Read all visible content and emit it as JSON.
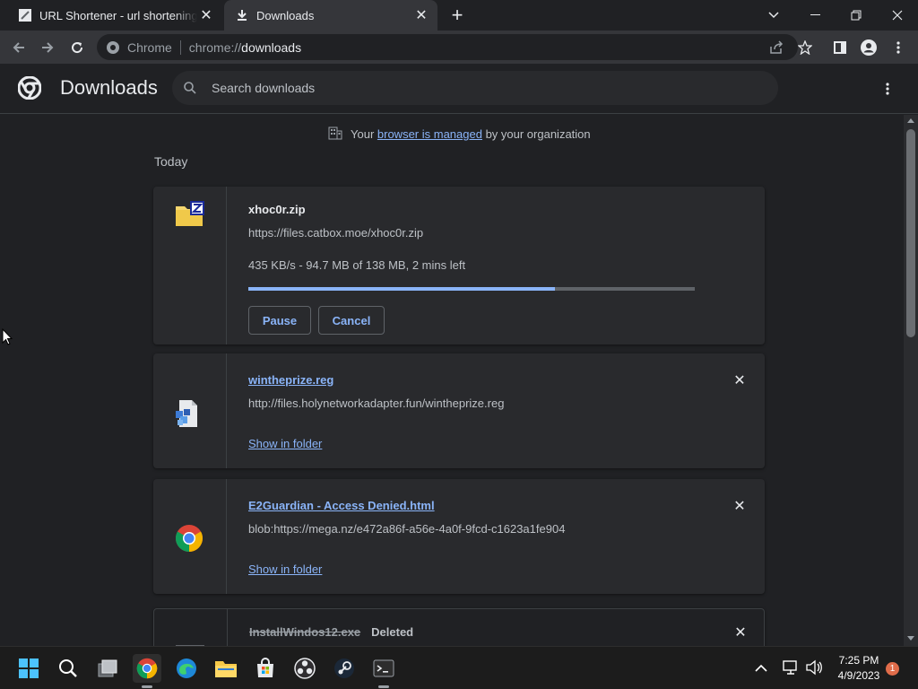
{
  "tabs": [
    {
      "title": "URL Shortener - url shortening service",
      "active": false
    },
    {
      "title": "Downloads",
      "active": true
    }
  ],
  "omnibox": {
    "chip": "Chrome",
    "url_scheme": "chrome://",
    "url_host": "downloads"
  },
  "page": {
    "title": "Downloads",
    "search_placeholder": "Search downloads",
    "managed": {
      "prefix": "Your ",
      "link": "browser is managed",
      "suffix": " by your organization"
    },
    "section": "Today"
  },
  "downloads": [
    {
      "name": "xhoc0r.zip",
      "url": "https://files.catbox.moe/xhoc0r.zip",
      "status": "435 KB/s - 94.7 MB of 138 MB, 2 mins left",
      "progress": 0.686,
      "pause_label": "Pause",
      "cancel_label": "Cancel"
    },
    {
      "name": "wintheprize.reg",
      "url": "http://files.holynetworkadapter.fun/wintheprize.reg",
      "action": "Show in folder"
    },
    {
      "name": "E2Guardian - Access Denied.html",
      "url": "blob:https://mega.nz/e472a86f-a56e-4a0f-9fcd-c1623a1fe904",
      "action": "Show in folder"
    },
    {
      "name": "InstallWindos12.exe",
      "tag": "Deleted"
    }
  ],
  "taskbar": {
    "time": "7:25 PM",
    "date": "4/9/2023",
    "notifications": "1"
  },
  "colors": {
    "accent": "#8ab4f8",
    "background": "#202124",
    "card": "#292a2d"
  }
}
